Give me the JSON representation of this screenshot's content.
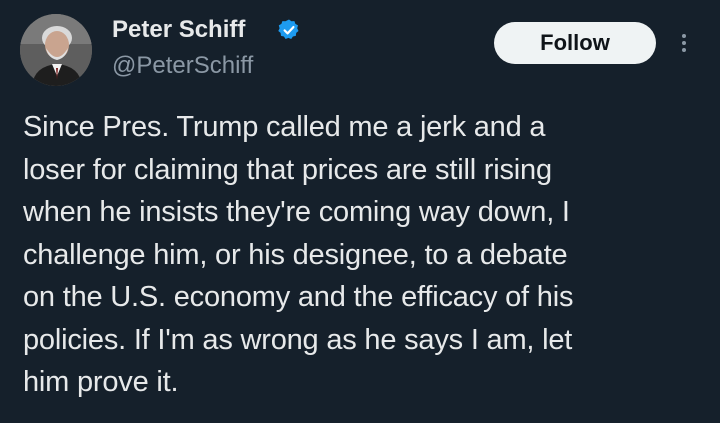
{
  "author": {
    "display_name": "Peter Schiff",
    "handle": "@PeterSchiff",
    "verified_icon": "verified-badge-icon",
    "avatar_icon": "profile-photo"
  },
  "follow_button": {
    "label": "Follow"
  },
  "more_menu": {
    "icon": "more-vertical-icon"
  },
  "tweet": {
    "lines": [
      "Since Pres. Trump called me a jerk and a",
      "loser for claiming that prices are still rising",
      "when he insists they're coming way down, I",
      "challenge him, or his designee, to a debate",
      "on the U.S. economy and the efficacy of his",
      "policies. If I'm as wrong as he says I am, let",
      "him prove it."
    ]
  },
  "colors": {
    "background": "#15202b",
    "text_primary": "#e7e9ea",
    "text_secondary": "#8b98a5",
    "verified_blue": "#1d9bf0",
    "button_bg": "#eff3f4",
    "button_text": "#0f1419"
  }
}
